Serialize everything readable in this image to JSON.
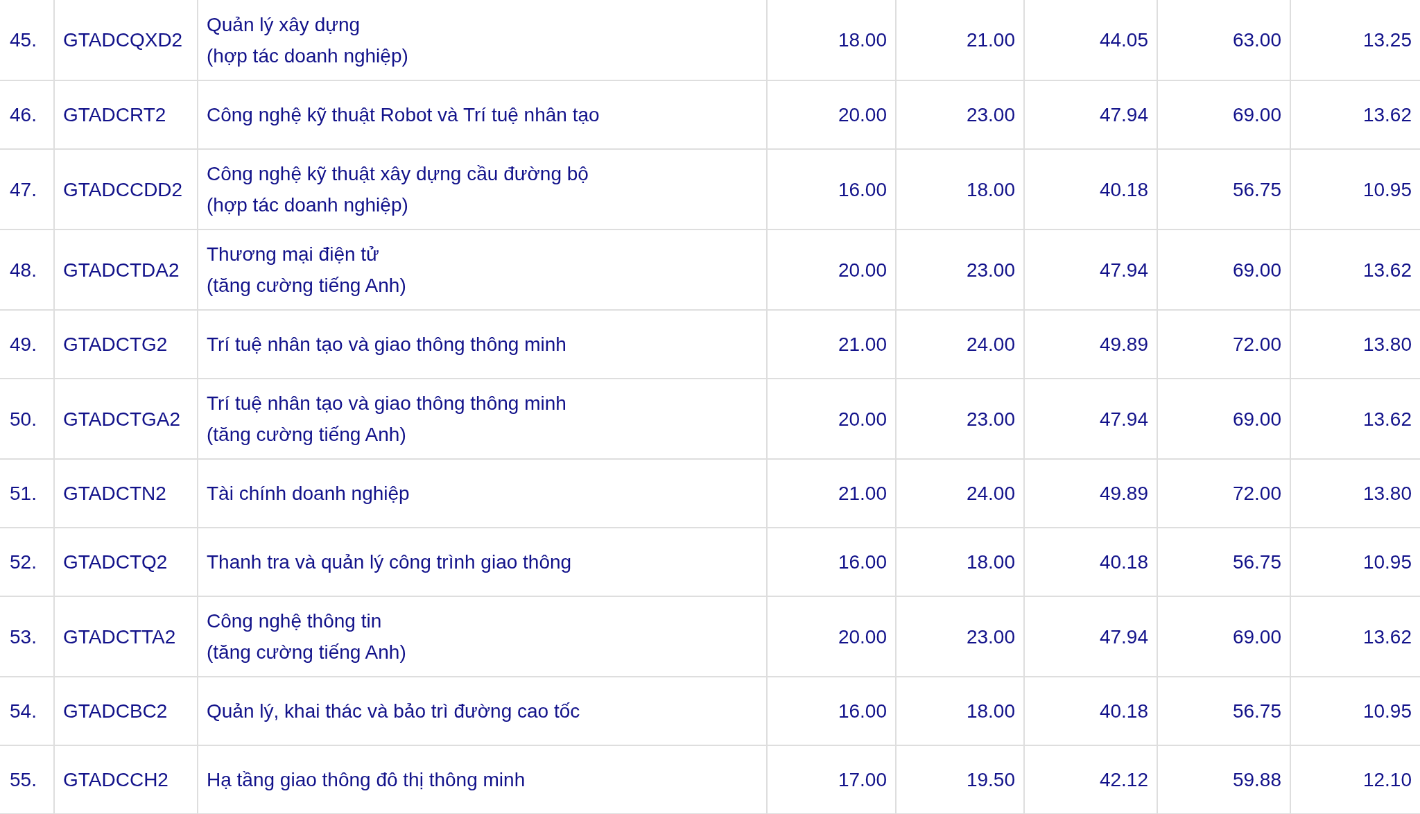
{
  "table": {
    "rows": [
      {
        "column_1": "45.",
        "column_2": "GTADCQXD2",
        "column_3": [
          "Quản lý xây dựng",
          "(hợp tác doanh nghiệp)"
        ],
        "column_4": "18.00",
        "column_5": "21.00",
        "column_6": "44.05",
        "column_7": "63.00",
        "column_8": "13.25"
      },
      {
        "column_1": "46.",
        "column_2": "GTADCRT2",
        "column_3": [
          "Công nghệ kỹ thuật Robot và Trí tuệ nhân tạo"
        ],
        "column_4": "20.00",
        "column_5": "23.00",
        "column_6": "47.94",
        "column_7": "69.00",
        "column_8": "13.62"
      },
      {
        "column_1": "47.",
        "column_2": "GTADCCDD2",
        "column_3": [
          "Công nghệ kỹ thuật xây dựng cầu đường bộ",
          "(hợp tác doanh nghiệp)"
        ],
        "column_4": "16.00",
        "column_5": "18.00",
        "column_6": "40.18",
        "column_7": "56.75",
        "column_8": "10.95"
      },
      {
        "column_1": "48.",
        "column_2": "GTADCTDA2",
        "column_3": [
          "Thương mại điện tử",
          "(tăng cường tiếng Anh)"
        ],
        "column_4": "20.00",
        "column_5": "23.00",
        "column_6": "47.94",
        "column_7": "69.00",
        "column_8": "13.62"
      },
      {
        "column_1": "49.",
        "column_2": "GTADCTG2",
        "column_3": [
          "Trí tuệ nhân tạo và giao thông thông minh"
        ],
        "column_4": "21.00",
        "column_5": "24.00",
        "column_6": "49.89",
        "column_7": "72.00",
        "column_8": "13.80"
      },
      {
        "column_1": "50.",
        "column_2": "GTADCTGA2",
        "column_3": [
          "Trí tuệ nhân tạo và giao thông thông minh",
          "(tăng cường tiếng Anh)"
        ],
        "column_4": "20.00",
        "column_5": "23.00",
        "column_6": "47.94",
        "column_7": "69.00",
        "column_8": "13.62"
      },
      {
        "column_1": "51.",
        "column_2": "GTADCTN2",
        "column_3": [
          "Tài chính doanh nghiệp"
        ],
        "column_4": "21.00",
        "column_5": "24.00",
        "column_6": "49.89",
        "column_7": "72.00",
        "column_8": "13.80"
      },
      {
        "column_1": "52.",
        "column_2": "GTADCTQ2",
        "column_3": [
          "Thanh tra và quản lý công trình giao thông"
        ],
        "column_4": "16.00",
        "column_5": "18.00",
        "column_6": "40.18",
        "column_7": "56.75",
        "column_8": "10.95"
      },
      {
        "column_1": "53.",
        "column_2": "GTADCTTA2",
        "column_3": [
          "Công nghệ thông tin",
          "(tăng cường tiếng Anh)"
        ],
        "column_4": "20.00",
        "column_5": "23.00",
        "column_6": "47.94",
        "column_7": "69.00",
        "column_8": "13.62"
      },
      {
        "column_1": "54.",
        "column_2": "GTADCBC2",
        "column_3": [
          "Quản lý, khai thác và bảo trì đường cao tốc"
        ],
        "column_4": "16.00",
        "column_5": "18.00",
        "column_6": "40.18",
        "column_7": "56.75",
        "column_8": "10.95"
      },
      {
        "column_1": "55.",
        "column_2": "GTADCCH2",
        "column_3": [
          "Hạ tầng giao thông đô thị thông minh"
        ],
        "column_4": "17.00",
        "column_5": "19.50",
        "column_6": "42.12",
        "column_7": "59.88",
        "column_8": "12.10"
      }
    ]
  }
}
